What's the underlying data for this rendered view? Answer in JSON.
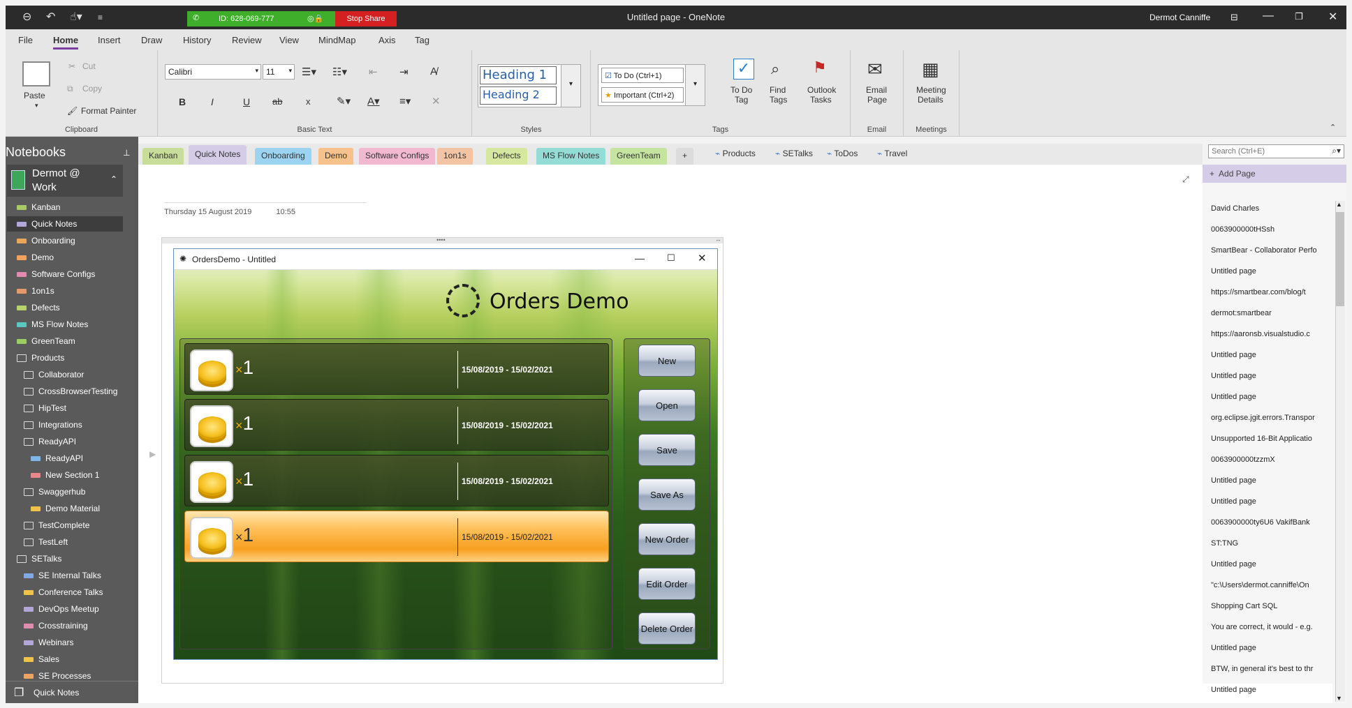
{
  "app": {
    "window_title": "Untitled page  -  OneNote",
    "user_name": "Dermot Canniffe"
  },
  "share_bar": {
    "id_label": "ID: 628-069-777",
    "stop_label": "Stop Share"
  },
  "menu": [
    "File",
    "Home",
    "Insert",
    "Draw",
    "History",
    "Review",
    "View",
    "MindMap",
    "Axis",
    "Tag"
  ],
  "ribbon": {
    "clipboard": {
      "paste": "Paste",
      "cut": "Cut",
      "copy": "Copy",
      "format_painter": "Format Painter",
      "label": "Clipboard"
    },
    "basic_text": {
      "font": "Calibri",
      "size": "11",
      "label": "Basic Text",
      "bold": "B",
      "italic": "I",
      "underline": "U",
      "strike": "ab",
      "sub": "x"
    },
    "styles": {
      "heading1": "Heading 1",
      "heading2": "Heading 2",
      "label": "Styles"
    },
    "tags": {
      "todo": "To Do (Ctrl+1)",
      "important": "Important (Ctrl+2)",
      "todo_tag_1": "To Do",
      "todo_tag_2": "Tag",
      "find_tags_1": "Find",
      "find_tags_2": "Tags",
      "outlook_1": "Outlook",
      "outlook_2": "Tasks",
      "label": "Tags"
    },
    "email": {
      "line1": "Email",
      "line2": "Page",
      "label": "Email"
    },
    "meetings": {
      "line1": "Meeting",
      "line2": "Details",
      "label": "Meetings"
    }
  },
  "notebooks": {
    "header": "Notebooks",
    "current_1": "Dermot @",
    "current_2": "Work",
    "sections": [
      {
        "label": "Kanban",
        "color": "#a8c96a",
        "type": "section",
        "indent": 0
      },
      {
        "label": "Quick Notes",
        "color": "#b3a6d9",
        "type": "section",
        "indent": 0,
        "selected": true
      },
      {
        "label": "Onboarding",
        "color": "#e8a65a",
        "type": "section",
        "indent": 0
      },
      {
        "label": "Demo",
        "color": "#f0a25f",
        "type": "section",
        "indent": 0
      },
      {
        "label": "Software Configs",
        "color": "#e28bb0",
        "type": "section",
        "indent": 0
      },
      {
        "label": "1on1s",
        "color": "#e29a6b",
        "type": "section",
        "indent": 0
      },
      {
        "label": "Defects",
        "color": "#b6d16d",
        "type": "section",
        "indent": 0
      },
      {
        "label": "MS Flow Notes",
        "color": "#5cc6c0",
        "type": "section",
        "indent": 0
      },
      {
        "label": "GreenTeam",
        "color": "#9ccc65",
        "type": "section",
        "indent": 0
      },
      {
        "label": "Products",
        "type": "group",
        "indent": 0
      },
      {
        "label": "Collaborator",
        "type": "group",
        "indent": 1
      },
      {
        "label": "CrossBrowserTesting",
        "type": "group",
        "indent": 1
      },
      {
        "label": "HipTest",
        "type": "group",
        "indent": 1
      },
      {
        "label": "Integrations",
        "type": "group",
        "indent": 1
      },
      {
        "label": "ReadyAPI",
        "type": "group",
        "indent": 1
      },
      {
        "label": "ReadyAPI",
        "color": "#7fb6e8",
        "type": "section",
        "indent": 2
      },
      {
        "label": "New Section 1",
        "color": "#e8888a",
        "type": "section",
        "indent": 2
      },
      {
        "label": "Swaggerhub",
        "type": "group",
        "indent": 1
      },
      {
        "label": "Demo Material",
        "color": "#f0c24a",
        "type": "section",
        "indent": 2
      },
      {
        "label": "TestComplete",
        "type": "group",
        "indent": 1
      },
      {
        "label": "TestLeft",
        "type": "group",
        "indent": 1
      },
      {
        "label": "SETalks",
        "type": "group",
        "indent": 0
      },
      {
        "label": "SE Internal Talks",
        "color": "#7fa9e8",
        "type": "section",
        "indent": 1
      },
      {
        "label": "Conference Talks",
        "color": "#f0c24a",
        "type": "section",
        "indent": 1
      },
      {
        "label": "DevOps Meetup",
        "color": "#b3a6d9",
        "type": "section",
        "indent": 1
      },
      {
        "label": "Crosstraining",
        "color": "#e28bb0",
        "type": "section",
        "indent": 1
      },
      {
        "label": "Webinars",
        "color": "#b3a6d9",
        "type": "section",
        "indent": 1
      },
      {
        "label": "Sales",
        "color": "#f0c24a",
        "type": "section",
        "indent": 1
      },
      {
        "label": "SE Processes",
        "color": "#f0a25f",
        "type": "section",
        "indent": 1
      }
    ],
    "footer": "Quick Notes"
  },
  "tabs": [
    {
      "label": "Kanban",
      "color": "#c9dd9a"
    },
    {
      "label": "Quick Notes",
      "color": "#d5cce8",
      "active": true
    },
    {
      "label": "Onboarding",
      "color": "#9bd3f0"
    },
    {
      "label": "Demo",
      "color": "#f6c18a"
    },
    {
      "label": "Software Configs",
      "color": "#f2b8d0"
    },
    {
      "label": "1on1s",
      "color": "#f2c4a4"
    },
    {
      "label": "Defects",
      "color": "#d6e8a0"
    },
    {
      "label": "MS Flow Notes",
      "color": "#96dcd6"
    },
    {
      "label": "GreenTeam",
      "color": "#c4e4a0"
    },
    {
      "label": "+",
      "color": "#dcdcdc"
    }
  ],
  "group_tabs": [
    "Products",
    "SETalks",
    "ToDos",
    "Travel"
  ],
  "search": {
    "placeholder": "Search (Ctrl+E)"
  },
  "page": {
    "date": "Thursday 15 August 2019",
    "time": "10:55"
  },
  "orders_app": {
    "window_title": "OrdersDemo - Untitled",
    "heading": "Orders Demo",
    "rows": [
      {
        "qty_prefix": "×",
        "qty": "1",
        "dates": "15/08/2019 - 15/02/2021",
        "selected": false
      },
      {
        "qty_prefix": "×",
        "qty": "1",
        "dates": "15/08/2019 - 15/02/2021",
        "selected": false
      },
      {
        "qty_prefix": "×",
        "qty": "1",
        "dates": "15/08/2019 - 15/02/2021",
        "selected": false
      },
      {
        "qty_prefix": "×",
        "qty": "1",
        "dates": "15/08/2019 - 15/02/2021",
        "selected": true
      }
    ],
    "buttons": [
      "New",
      "Open",
      "Save",
      "Save As",
      "New Order",
      "Edit Order",
      "Delete Order"
    ]
  },
  "page_list": {
    "add_page": "Add Page",
    "pages": [
      "David Charles",
      "0063900000tHSsh",
      "SmartBear - Collaborator Perfo",
      "Untitled page",
      "https://smartbear.com/blog/t",
      "dermot:smartbear",
      "https://aaronsb.visualstudio.c",
      "Untitled page",
      "Untitled page",
      "Untitled page",
      "org.eclipse.jgit.errors.Transpor",
      "Unsupported 16-Bit Applicatio",
      "0063900000tzzmX",
      "Untitled page",
      "Untitled page",
      "0063900000ty6U6 VakifBank",
      "ST:TNG",
      "Untitled page",
      "\"c:\\Users\\dermot.canniffe\\On",
      "Shopping Cart SQL",
      "You are correct, it would - e.g.",
      "Untitled page",
      "BTW, in general it's best to thr",
      "Untitled page"
    ]
  }
}
